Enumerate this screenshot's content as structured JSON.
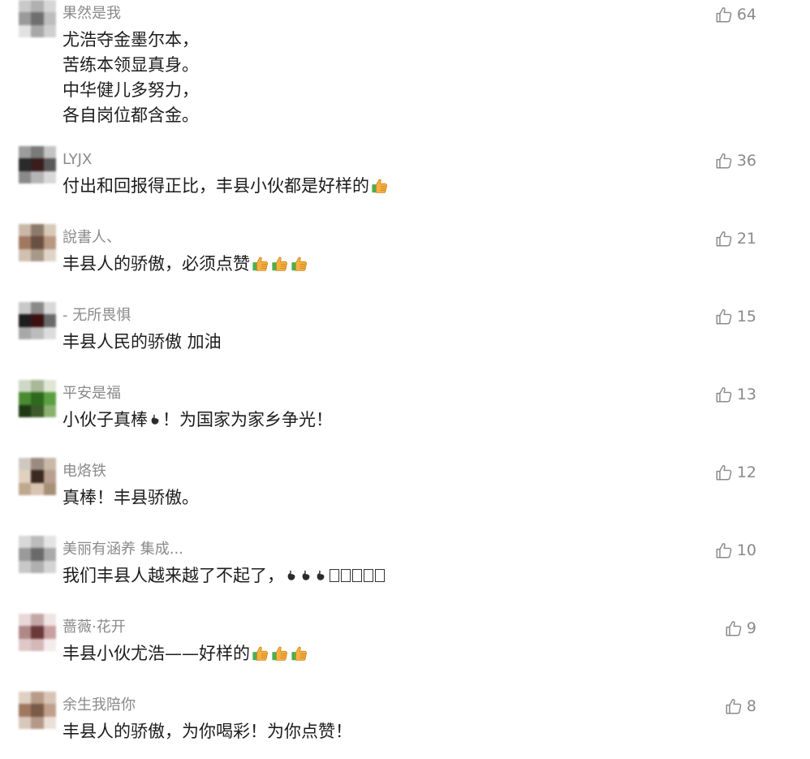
{
  "comments": [
    {
      "nickname": "果然是我",
      "lines": [
        "尤浩夺金墨尔本，",
        "苦练本领显真身。",
        "中华健儿多努力，",
        "各自岗位都含金。"
      ],
      "suffix_emoji": [],
      "likes": "64",
      "avatar_colors": [
        "#c9c9c9",
        "#b0b0b0",
        "#d6d6d6",
        "#9a9a9a",
        "#6f6f6f",
        "#bdbdbd",
        "#e2e2e2",
        "#a8a8a8",
        "#cfcfcf"
      ]
    },
    {
      "nickname": "LYJX",
      "lines": [
        "付出和回报得正比，丰县小伙都是好样的"
      ],
      "suffix_emoji": [
        "thumbs-up"
      ],
      "likes": "36",
      "avatar_colors": [
        "#9c9c9c",
        "#7a7a7a",
        "#c4c4c4",
        "#2a2a2a",
        "#3a1e1e",
        "#5a5a5a",
        "#8a8a8a",
        "#b5b5b5",
        "#d8d8d8"
      ]
    },
    {
      "nickname": "說書人、",
      "lines": [
        "丰县人的骄傲，必须点赞"
      ],
      "suffix_emoji": [
        "thumbs-up",
        "thumbs-up",
        "thumbs-up"
      ],
      "likes": "21",
      "avatar_colors": [
        "#c9b8a8",
        "#8c7a6a",
        "#d8c8b8",
        "#a07860",
        "#6a5040",
        "#b89880",
        "#d0c0b0",
        "#a89888",
        "#e0d4c8"
      ]
    },
    {
      "nickname": "- 无所畏惧",
      "lines": [
        "丰县人民的骄傲 加油"
      ],
      "suffix_emoji": [],
      "likes": "15",
      "avatar_colors": [
        "#c8c8c8",
        "#8a8a8a",
        "#d8d8d8",
        "#1e1e1e",
        "#3c1010",
        "#6a6a6a",
        "#a8a8a8",
        "#bcbcbc",
        "#dcdcdc"
      ]
    },
    {
      "nickname": "平安是福",
      "lines": [
        "小伙子真棒",
        "！为国家为家乡争光！"
      ],
      "suffix_emoji": [],
      "inline_point_after_first": true,
      "likes": "13",
      "avatar_colors": [
        "#cfd8c4",
        "#a8b898",
        "#dfe6d4",
        "#4a8a30",
        "#2e6a1e",
        "#5aa040",
        "#1e3a14",
        "#3c5a2a",
        "#8ab070"
      ]
    },
    {
      "nickname": "电烙铁",
      "lines": [
        "真棒！丰县骄傲。"
      ],
      "suffix_emoji": [],
      "likes": "12",
      "avatar_colors": [
        "#d0c8c0",
        "#9a8a80",
        "#c8b8a8",
        "#e0d0c0",
        "#3a2a22",
        "#b8a090",
        "#c0a890",
        "#d8c4b0",
        "#a89078"
      ]
    },
    {
      "nickname": "美丽有涵养 集成...",
      "lines": [
        "我们丰县人越来越了不起了，"
      ],
      "suffix_emoji": [],
      "trailing_points": 3,
      "trailing_boxes": 5,
      "likes": "10",
      "avatar_colors": [
        "#d8d8d8",
        "#bcbcbc",
        "#e4e4e4",
        "#9a9a9a",
        "#6a6a6a",
        "#aaaaaa",
        "#c8c8c8",
        "#b0b0b0",
        "#d4d4d4"
      ]
    },
    {
      "nickname": "蔷薇·花开",
      "lines": [
        "丰县小伙尤浩——好样的"
      ],
      "suffix_emoji": [
        "thumbs-up",
        "thumbs-up",
        "thumbs-up"
      ],
      "likes": "9",
      "avatar_colors": [
        "#e8d8d8",
        "#c4a8a8",
        "#f0e4e4",
        "#b08888",
        "#6a3a3a",
        "#c8a0a0",
        "#e0c8c8",
        "#d4b8b8",
        "#f4ecec"
      ]
    },
    {
      "nickname": "余生我陪你",
      "lines": [
        "丰县人的骄傲，为你喝彩！为你点赞！"
      ],
      "suffix_emoji": [],
      "likes": "8",
      "avatar_colors": [
        "#e0d0c4",
        "#b89c88",
        "#d8c4b4",
        "#a07860",
        "#7a5a48",
        "#c0a08c",
        "#d8c8bc",
        "#b49888",
        "#ece0d6"
      ]
    }
  ],
  "colors": {
    "nickname": "#8a8a8a",
    "content": "#1c1c1c",
    "likes": "#8a8a8a",
    "emoji_thumb_skin": "#f5b041",
    "emoji_thumb_sleeve": "#4caf50",
    "emoji_point": "#2b2b2b"
  },
  "icons": {
    "like": "thumbs-up-outline-icon",
    "emoji_thumb": "thumbs-up-emoji-icon",
    "emoji_point": "pointing-finger-emoji-icon"
  }
}
